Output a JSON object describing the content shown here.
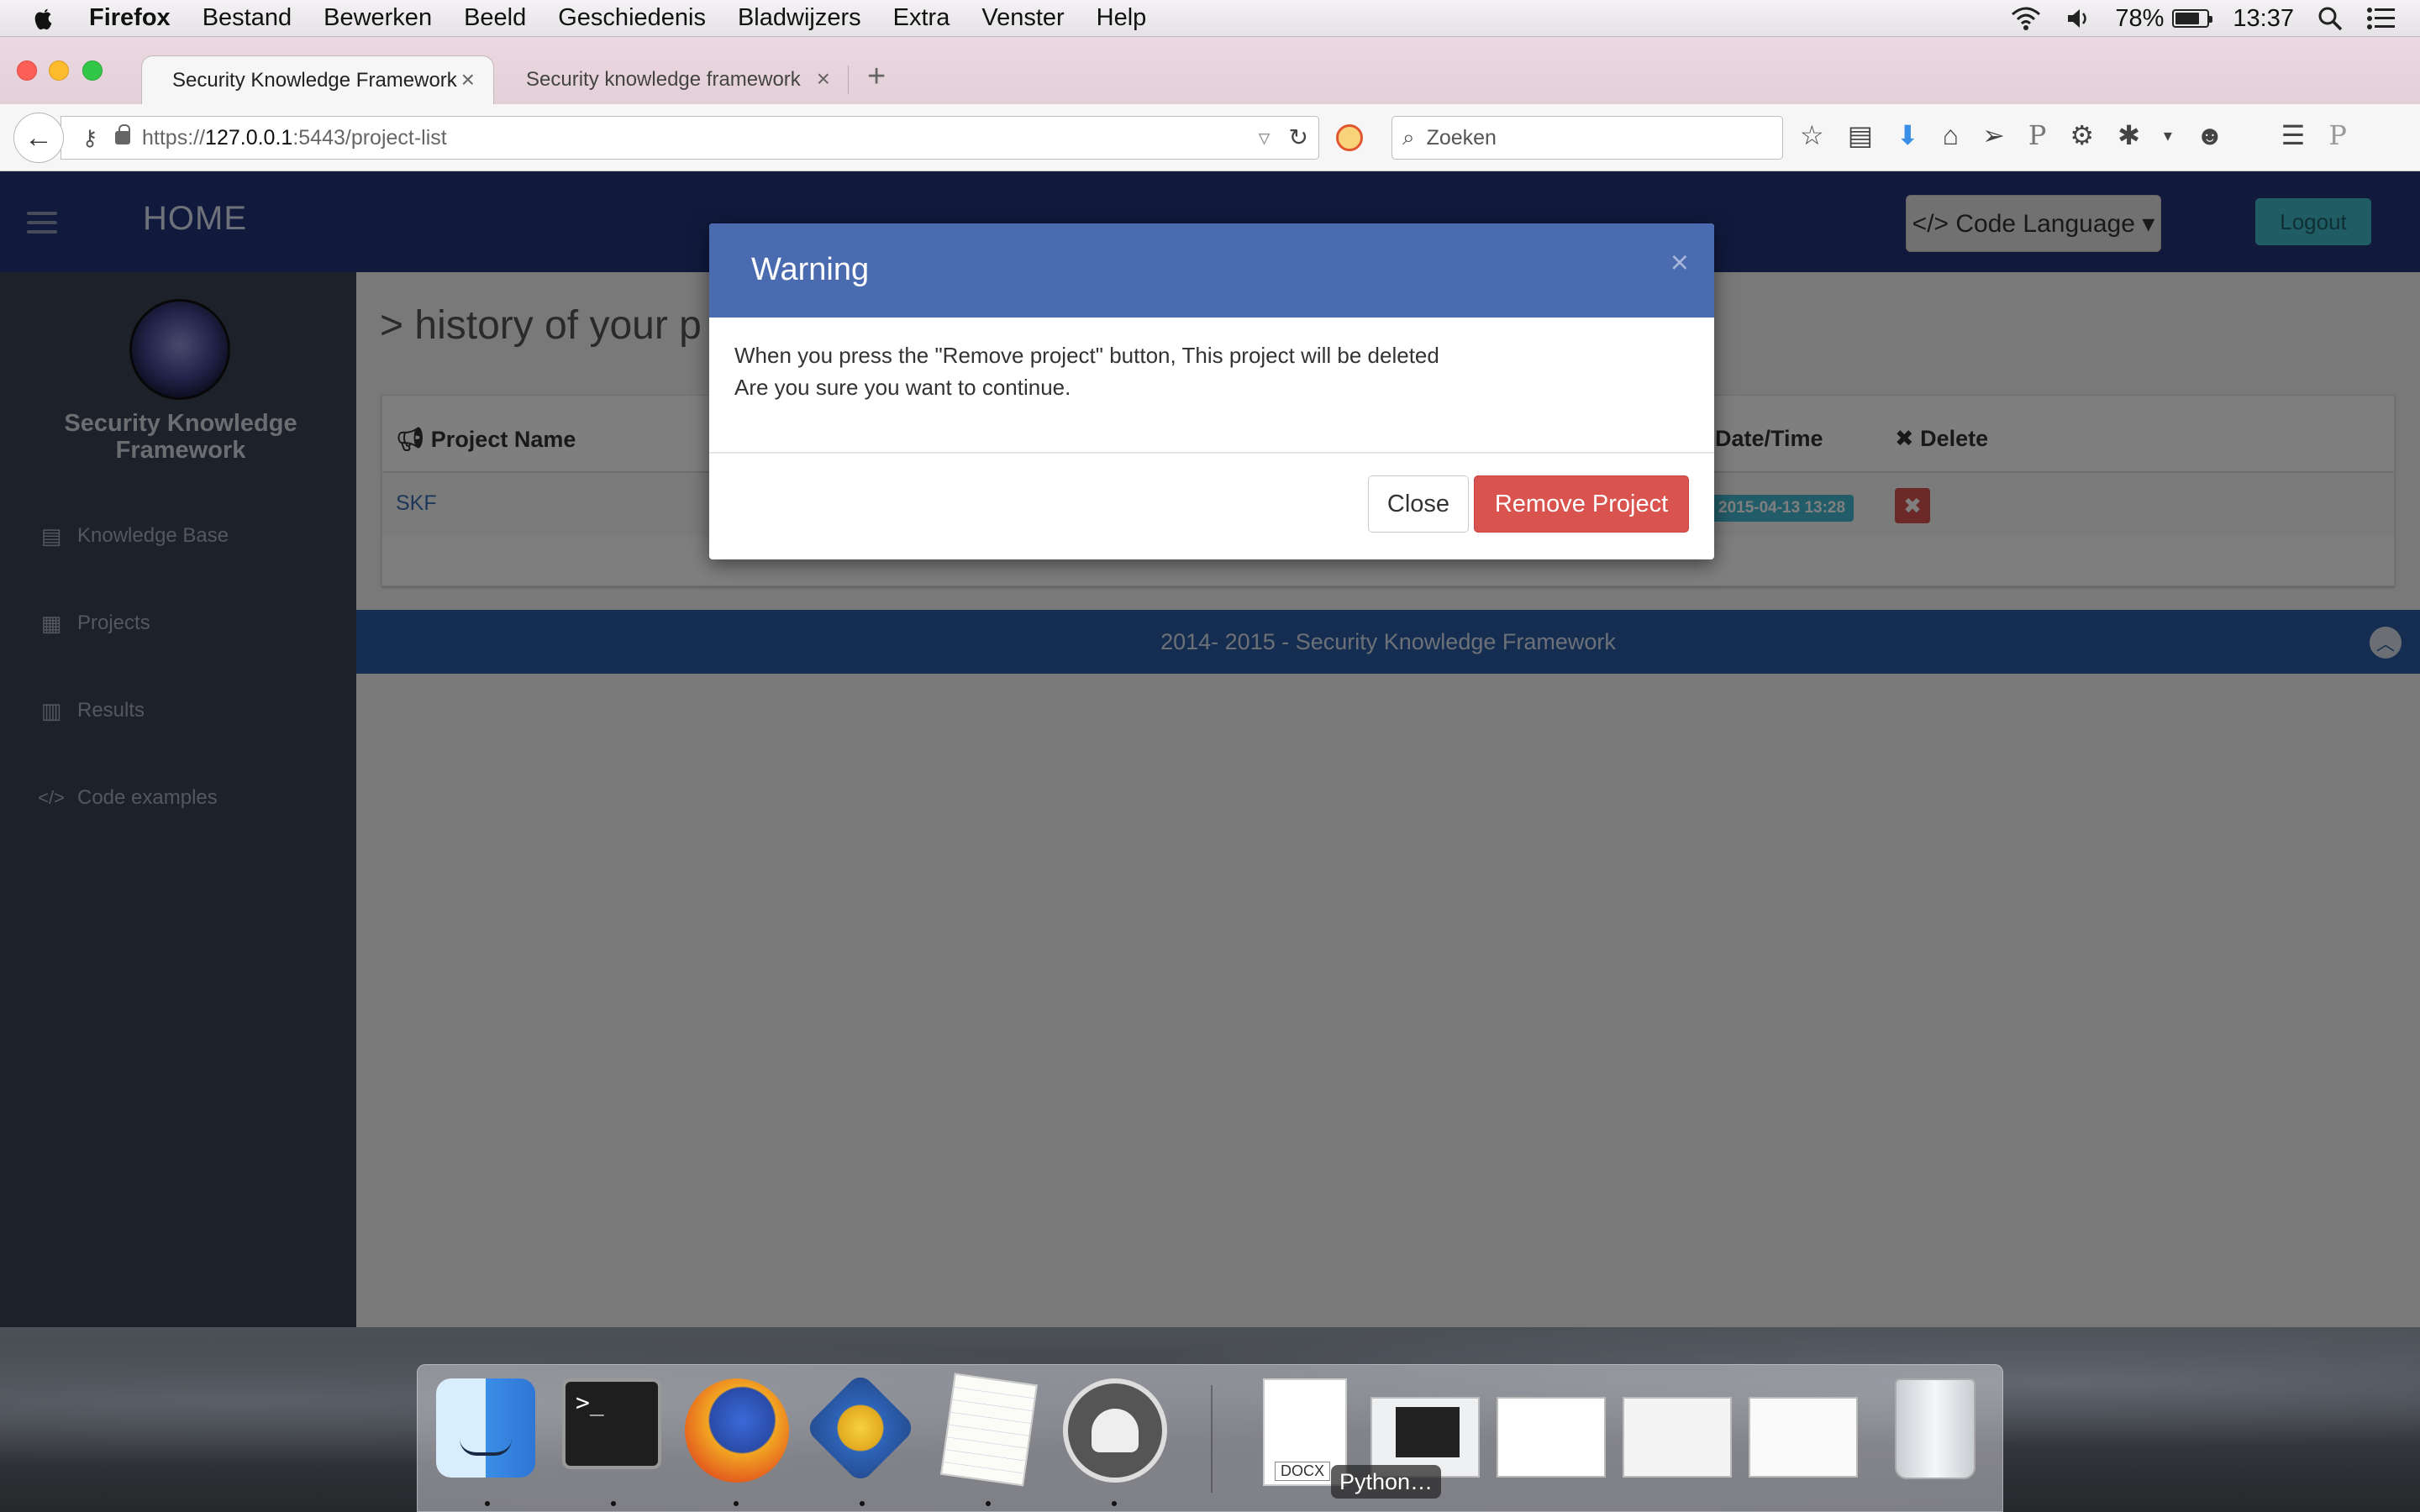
{
  "menubar": {
    "app_name": "Firefox",
    "menus": [
      "Bestand",
      "Bewerken",
      "Beeld",
      "Geschiedenis",
      "Bladwijzers",
      "Extra",
      "Venster",
      "Help"
    ],
    "battery": "78%",
    "clock": "13:37"
  },
  "browser": {
    "tabs": [
      {
        "title": "Security Knowledge Framework",
        "active": true
      },
      {
        "title": "Security knowledge framework",
        "active": false
      }
    ],
    "url_prefix": "https://",
    "url_host": "127.0.0.1",
    "url_rest": ":5443/project-list",
    "search_placeholder": "Zoeken"
  },
  "app": {
    "header_title": "HOME",
    "code_language_label": "</> Code Language ▾",
    "logout_label": "Logout",
    "brand": "Security Knowledge Framework",
    "nav": [
      {
        "label": "Knowledge Base",
        "icon": "book-icon"
      },
      {
        "label": "Projects",
        "icon": "grid-icon"
      },
      {
        "label": "Results",
        "icon": "bar-chart-icon"
      },
      {
        "label": "Code examples",
        "icon": "code-icon"
      }
    ],
    "page_heading": "> history of your p",
    "table": {
      "headers": {
        "name": "Project Name",
        "datetime": "Date/Time",
        "delete": "Delete"
      },
      "rows": [
        {
          "name": "SKF",
          "datetime": "2015-04-13 13:28"
        }
      ]
    },
    "footer": "2014- 2015 - Security Knowledge Framework"
  },
  "modal": {
    "title": "Warning",
    "close_x": "×",
    "body_line1": "When you press the \"Remove project\" button, This project will be deleted",
    "body_line2": "Are you sure you want to continue.",
    "close_button": "Close",
    "remove_button": "Remove Project"
  },
  "dock": {
    "items": [
      "Finder",
      "Terminal",
      "Firefox",
      "TextWrangler",
      "TextEdit",
      "MAMP"
    ],
    "docx_label": "DOCX",
    "python_label": "Python…"
  },
  "colors": {
    "header_bg": "#22347a",
    "sidebar_bg": "#3a4354",
    "modal_header": "#4a6bb0",
    "danger": "#d9534f",
    "footer": "#2b5aa0"
  }
}
